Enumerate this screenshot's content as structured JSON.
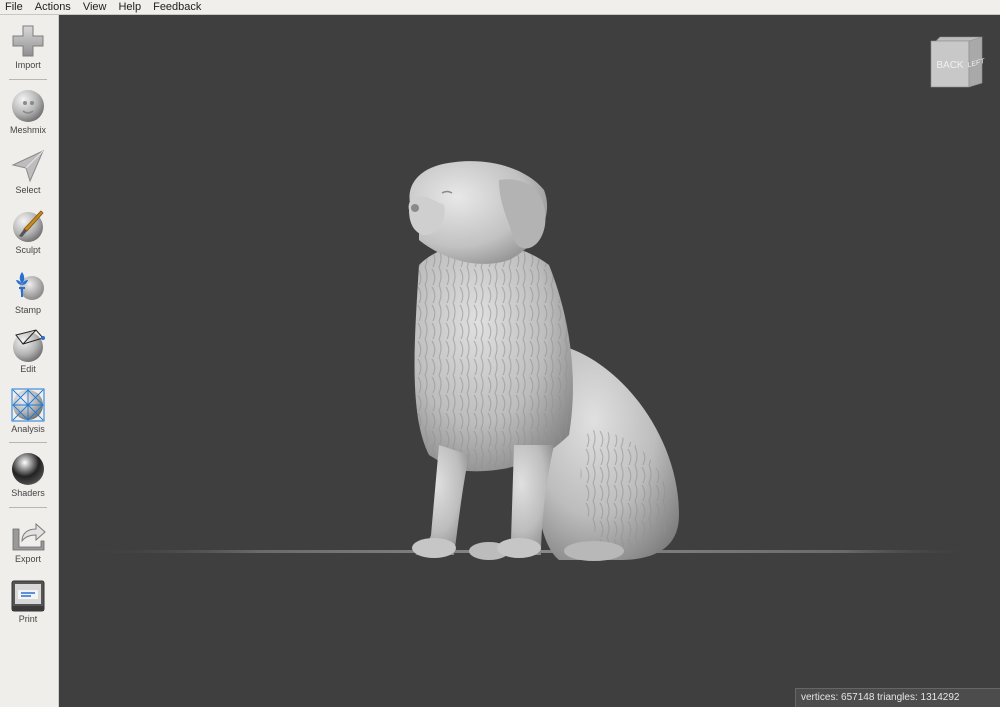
{
  "menubar": {
    "items": [
      "File",
      "Actions",
      "View",
      "Help",
      "Feedback"
    ]
  },
  "toolbar": {
    "tools": [
      {
        "label": "Import",
        "icon": "plus-icon"
      },
      {
        "label": "Meshmix",
        "icon": "meshmix-bunny-icon"
      },
      {
        "label": "Select",
        "icon": "select-arrow-icon"
      },
      {
        "label": "Sculpt",
        "icon": "sculpt-brush-icon"
      },
      {
        "label": "Stamp",
        "icon": "stamp-fleur-icon"
      },
      {
        "label": "Edit",
        "icon": "edit-wireframe-icon"
      },
      {
        "label": "Analysis",
        "icon": "analysis-mesh-icon"
      },
      {
        "label": "Shaders",
        "icon": "shader-sphere-icon"
      },
      {
        "label": "Export",
        "icon": "export-arrow-icon"
      },
      {
        "label": "Print",
        "icon": "printer-icon"
      }
    ]
  },
  "viewcube": {
    "face_front": "BACK",
    "face_side": "LEFT"
  },
  "status": {
    "text": "vertices: 657148 triangles: 1314292"
  },
  "colors": {
    "viewport_bg": "#3f3f3f",
    "toolbar_bg": "#efeeea",
    "model": "#c4c4c4"
  }
}
